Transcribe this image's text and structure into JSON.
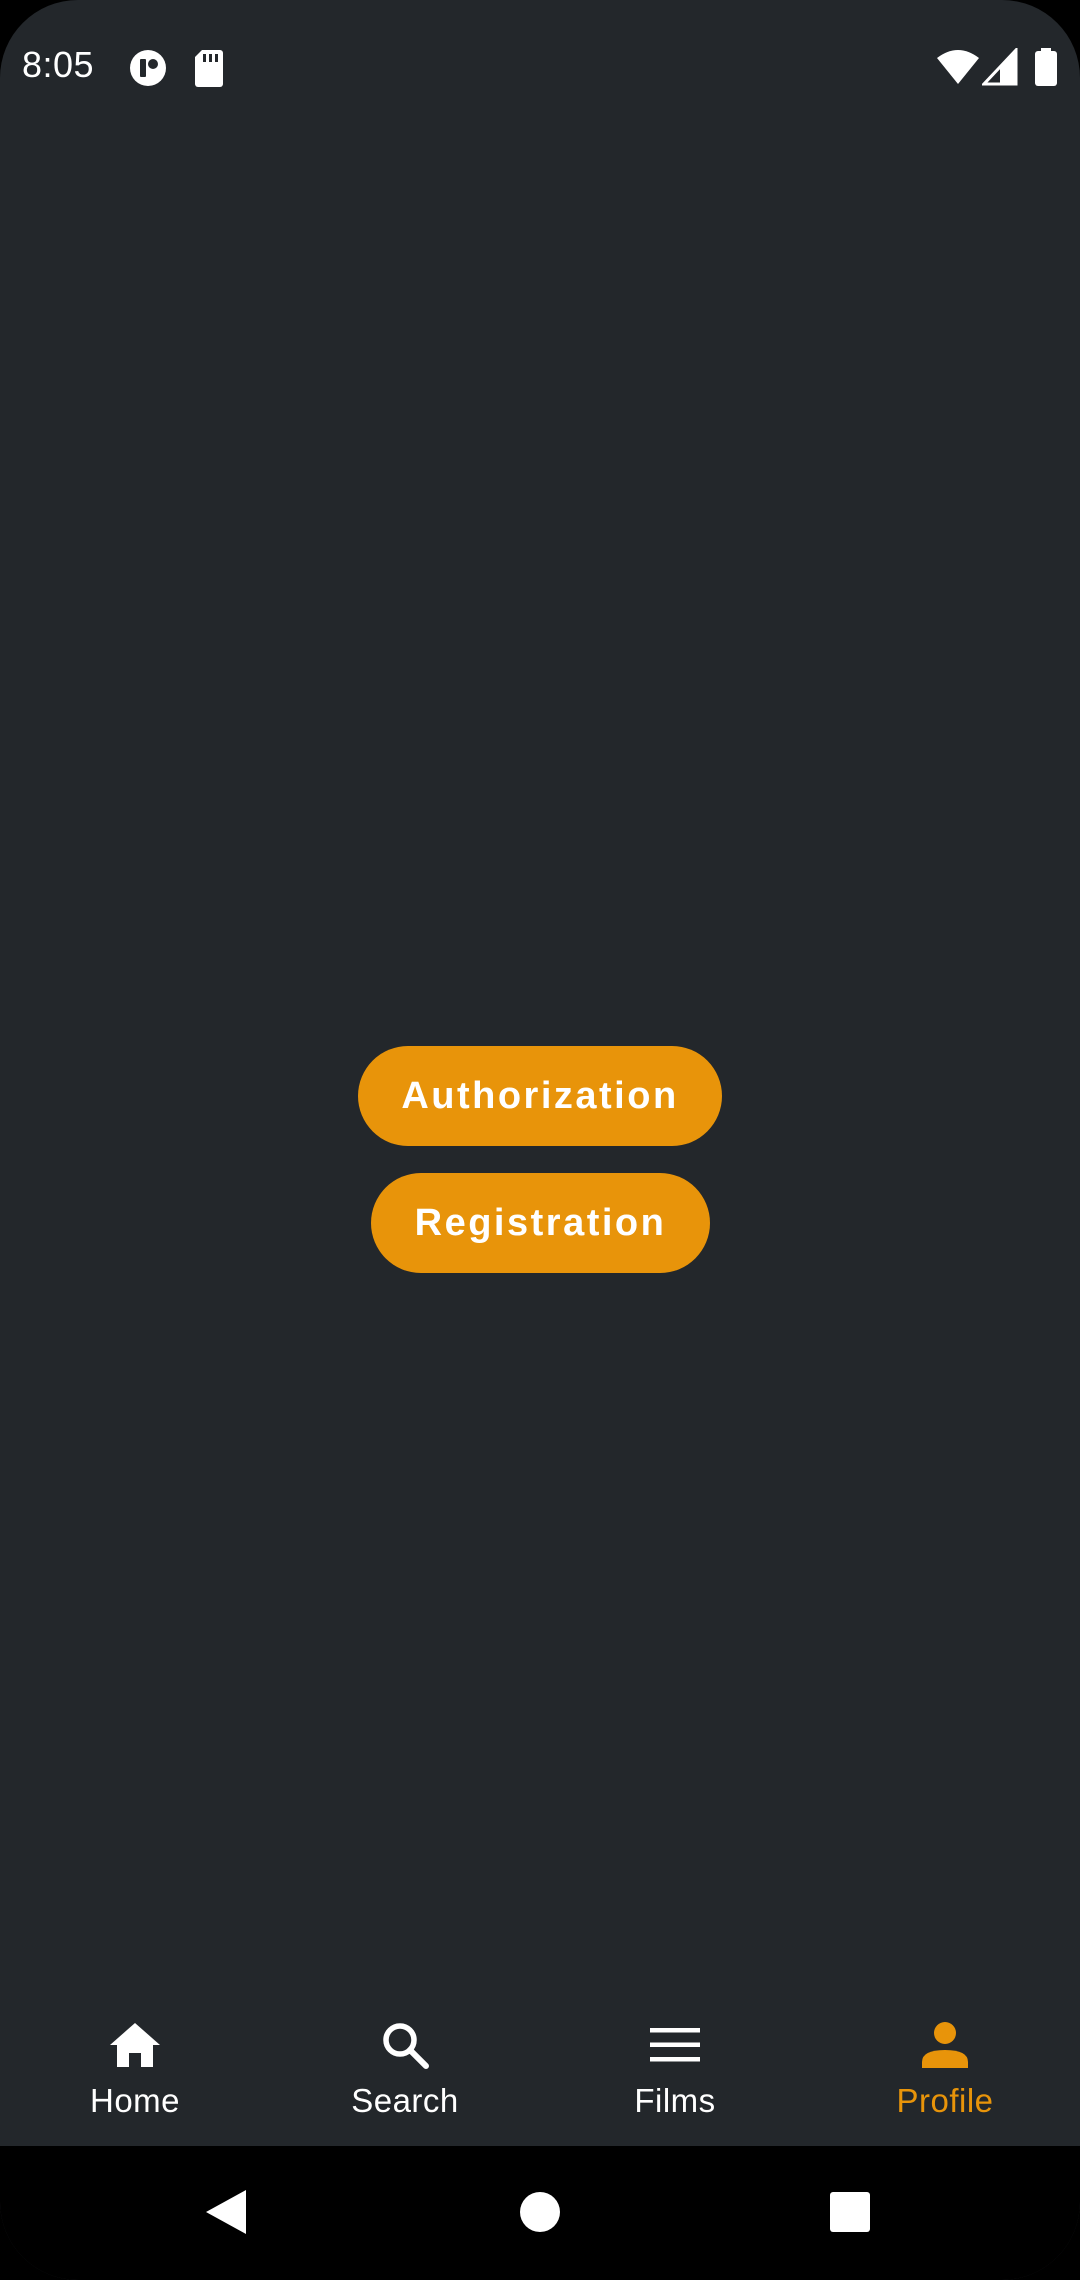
{
  "status_bar": {
    "time": "8:05",
    "left_icons": [
      "app-notification-icon",
      "sd-card-icon"
    ],
    "right_icons": [
      "wifi-icon",
      "cell-signal-icon",
      "battery-icon"
    ]
  },
  "main": {
    "authorization_label": "Authorization",
    "registration_label": "Registration"
  },
  "bottom_nav": {
    "items": [
      {
        "label": "Home",
        "icon": "home-icon",
        "active": false
      },
      {
        "label": "Search",
        "icon": "search-icon",
        "active": false
      },
      {
        "label": "Films",
        "icon": "menu-icon",
        "active": false
      },
      {
        "label": "Profile",
        "icon": "person-icon",
        "active": true
      }
    ]
  },
  "system_nav": [
    "back-icon",
    "home-circle-icon",
    "recents-icon"
  ],
  "colors": {
    "background": "#23272b",
    "accent": "#e8940a",
    "text": "#ffffff",
    "system_bar": "#000000"
  }
}
